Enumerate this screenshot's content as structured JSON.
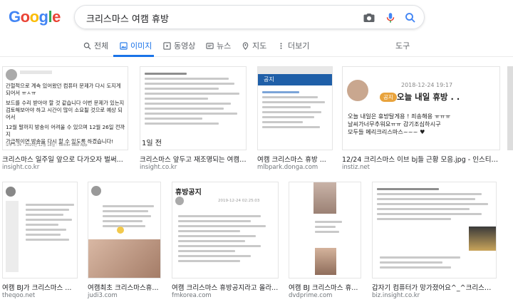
{
  "search": {
    "query": "크리스마스 여캠 휴방"
  },
  "tabs": [
    {
      "label": "전체",
      "icon": "search-icon"
    },
    {
      "label": "이미지",
      "icon": "image-icon"
    },
    {
      "label": "동영상",
      "icon": "video-icon"
    },
    {
      "label": "뉴스",
      "icon": "news-icon"
    },
    {
      "label": "지도",
      "icon": "map-pin-icon"
    },
    {
      "label": "더보기",
      "icon": "more-icon"
    }
  ],
  "tools_label": "도구",
  "results_row1": [
    {
      "title": "크리스마스 일주일 앞으로 다가오자 벌써...",
      "site": "insight.co.kr",
      "thumb_text": [
        "간헐적으로 계속 있어왔던 컴퓨터 문제가 다시 도지게",
        "되어서 ㅠㅅㅠ",
        "보드를 수리 받아야 할 것 같습니다 이번 문제가 있는지",
        "검토해보아야 하고 시간이 많이 소요될 것으로 예상 되",
        "어서",
        "12월 말까지 방송이 어려울 수 있으며 12월 26일 전까지",
        "가급적이면 방송을 다시 할 수 있도록 하겠습니다!"
      ],
      "thumb_footer": "오후 5:14 · 2020년 12월 18일 · Twitter Web App"
    },
    {
      "title": "크리스마스 앞두고 재조명되는 여캠 ...",
      "site": "insight.co.kr",
      "thumb_text": [
        "1일 전"
      ]
    },
    {
      "title": "여캠 크리스마스 휴방 ...",
      "site": "mlbpark.donga.com",
      "thumb_text": [
        "공지"
      ]
    },
    {
      "title": "12/24 크리스마스 이브 bj들 근황 모음.jpg - 인스티즈(i...",
      "site": "instiz.net",
      "thumb_text": [
        "2018-12-24 19:17",
        "공지",
        "오늘 내일 휴방 . .",
        "오늘 내일은 휴방탈게용 ! 죄송해용 ㅠㅠㅠ",
        "날씨가너무추워요ㅠㅠ 감기조심하시구",
        "모두들 메리크리스마스~~~ ♥"
      ]
    }
  ],
  "results_row2": [
    {
      "title": "여캠 BJ가 크리스마스 ...",
      "site": "theqoo.net"
    },
    {
      "title": "여캠최초 크리스마스휴...",
      "site": "judi3.com"
    },
    {
      "title": "여캠 크리스마스 휴방공지라고 올라...",
      "site": "fmkorea.com",
      "thumb_text": [
        "휴방공지",
        "2019-12-24 02:25:03"
      ]
    },
    {
      "title": "여캠 BJ 크리스마스 휴...",
      "site": "dvdprime.com"
    },
    {
      "title": "갑자기 컴퓨터가 망가졌어요^_^크리스마스 ...",
      "site": "biz.insight.co.kr"
    }
  ],
  "colors": {
    "accent": "#1a73e8",
    "link_gray": "#70757a",
    "badge": "#e8a33d"
  }
}
